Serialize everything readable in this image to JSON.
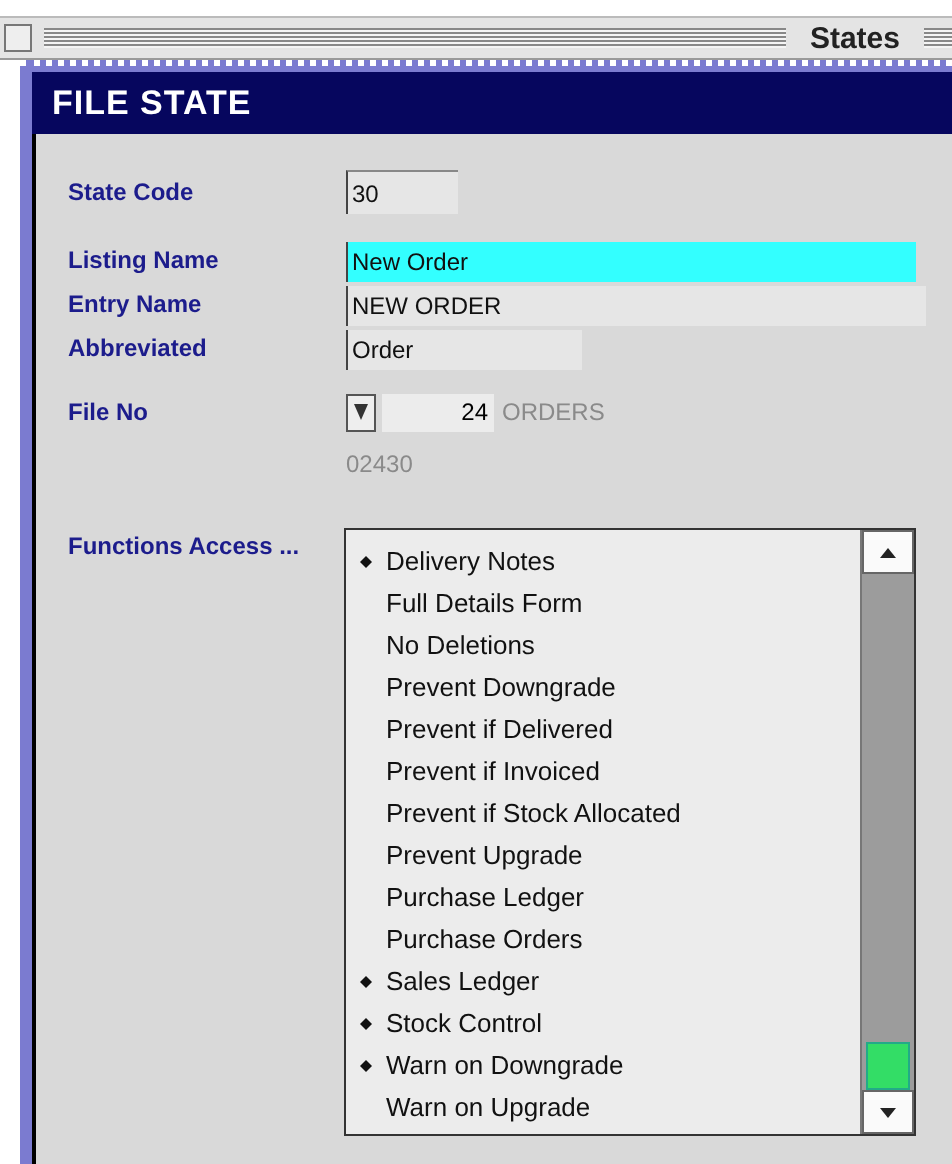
{
  "window": {
    "title": "States"
  },
  "header": {
    "title": "FILE STATE"
  },
  "fields": [
    {
      "label": "State Code",
      "value": "30",
      "kind": "short"
    },
    {
      "label": "Listing Name",
      "value": "New Order",
      "kind": "highlight"
    },
    {
      "label": "Entry Name",
      "value": "NEW ORDER",
      "kind": "wide"
    },
    {
      "label": "Abbreviated",
      "value": "Order",
      "kind": "medium"
    }
  ],
  "file_no": {
    "label": "File No",
    "value": "24",
    "file_name": "ORDERS",
    "code": "02430"
  },
  "functions": {
    "label": "Functions Access ...",
    "items": [
      {
        "name": "Delivery Notes",
        "marked": true
      },
      {
        "name": "Full Details Form",
        "marked": false
      },
      {
        "name": "No Deletions",
        "marked": false
      },
      {
        "name": "Prevent Downgrade",
        "marked": false
      },
      {
        "name": "Prevent if Delivered",
        "marked": false
      },
      {
        "name": "Prevent if Invoiced",
        "marked": false
      },
      {
        "name": "Prevent if Stock Allocated",
        "marked": false
      },
      {
        "name": "Prevent Upgrade",
        "marked": false
      },
      {
        "name": "Purchase Ledger",
        "marked": false
      },
      {
        "name": "Purchase Orders",
        "marked": false
      },
      {
        "name": "Sales Ledger",
        "marked": true
      },
      {
        "name": "Stock Control",
        "marked": true
      },
      {
        "name": "Warn on Downgrade",
        "marked": true
      },
      {
        "name": "Warn on Upgrade",
        "marked": false
      }
    ]
  }
}
